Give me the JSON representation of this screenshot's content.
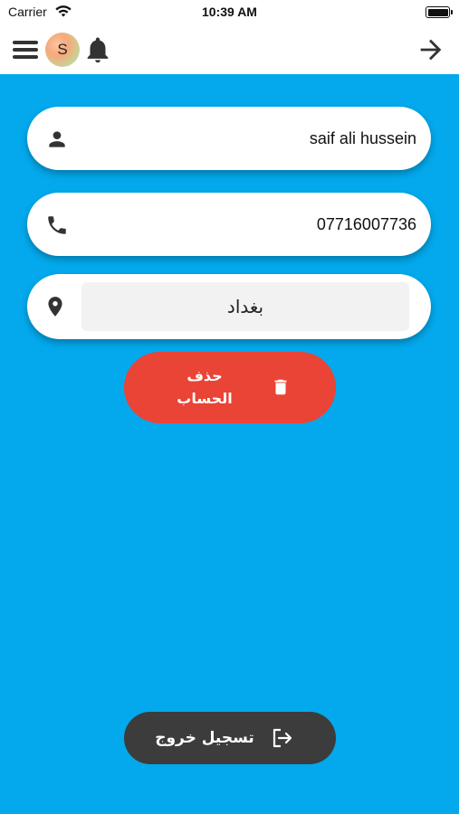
{
  "status_bar": {
    "carrier": "Carrier",
    "time": "10:39 AM"
  },
  "header": {
    "avatar_initial": "S",
    "icons": [
      "menu-icon",
      "bell-icon",
      "arrow-right-icon"
    ]
  },
  "profile": {
    "name": "saif ali hussein",
    "phone": "07716007736",
    "city": "بغداد"
  },
  "actions": {
    "delete_label_line1": "حذف",
    "delete_label_line2": "الحساب",
    "logout_label": "تسجيل خروج"
  },
  "colors": {
    "background": "#03a9ec",
    "delete": "#e94436",
    "logout": "#3c3c3c",
    "field": "#ffffff"
  }
}
